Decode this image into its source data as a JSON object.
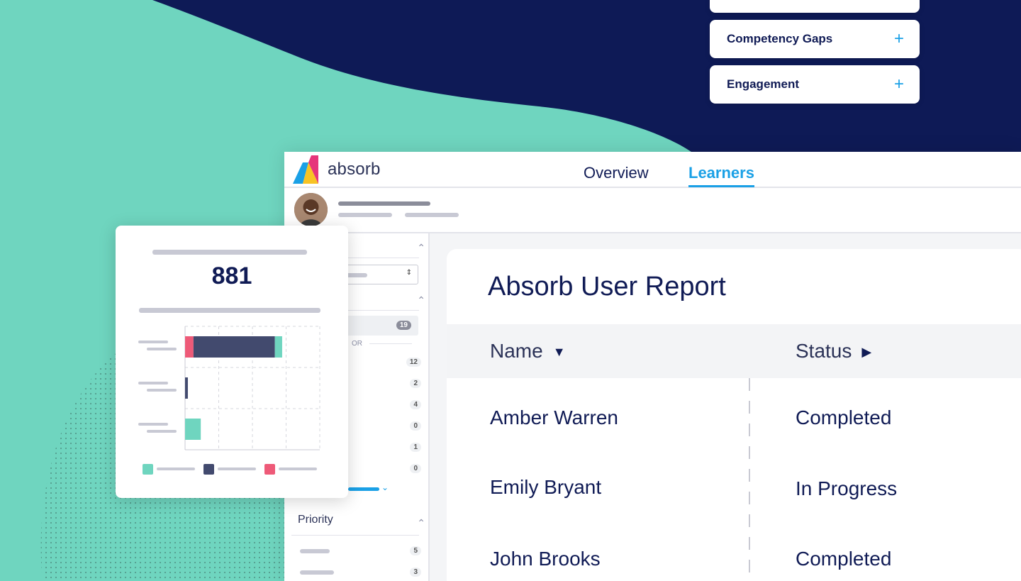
{
  "accordion": {
    "items": [
      {
        "label": ""
      },
      {
        "label": "Competency Gaps"
      },
      {
        "label": "Engagement"
      }
    ],
    "expand_glyph": "+"
  },
  "app": {
    "logo_text": "absorb",
    "tabs": [
      {
        "label": "Overview",
        "active": false
      },
      {
        "label": "Learners",
        "active": true
      }
    ],
    "accent_color": "#1aa0e6",
    "navy_color": "#101b55"
  },
  "sidebar": {
    "counts": [
      "19",
      "12",
      "2",
      "4",
      "0",
      "1",
      "0"
    ],
    "or_label": "OR",
    "priority_label": "Priority",
    "priority_counts": [
      "5",
      "3"
    ]
  },
  "report": {
    "title": "Absorb User Report",
    "columns": [
      {
        "label": "Name",
        "sort_icon": "caret-down-icon"
      },
      {
        "label": "Status",
        "sort_icon": "caret-right-icon"
      }
    ],
    "rows": [
      {
        "name": "Amber Warren",
        "status": "Completed"
      },
      {
        "name": "Emily Bryant",
        "status": "In Progress"
      },
      {
        "name": "John Brooks",
        "status": "Completed"
      }
    ]
  },
  "stats_card": {
    "value": "881"
  },
  "chart_data": {
    "type": "bar",
    "orientation": "horizontal",
    "stacked": true,
    "categories": [
      "",
      "",
      ""
    ],
    "series": [
      {
        "color": "#ee5a78",
        "values": [
          1.5,
          0,
          0
        ]
      },
      {
        "color": "#424a6e",
        "values": [
          14.5,
          0.5,
          0
        ]
      },
      {
        "color": "#6fd5bf",
        "values": [
          1.3,
          0,
          2.8
        ]
      }
    ],
    "xlim": [
      0,
      24
    ],
    "grid": true,
    "legend_position": "bottom"
  }
}
